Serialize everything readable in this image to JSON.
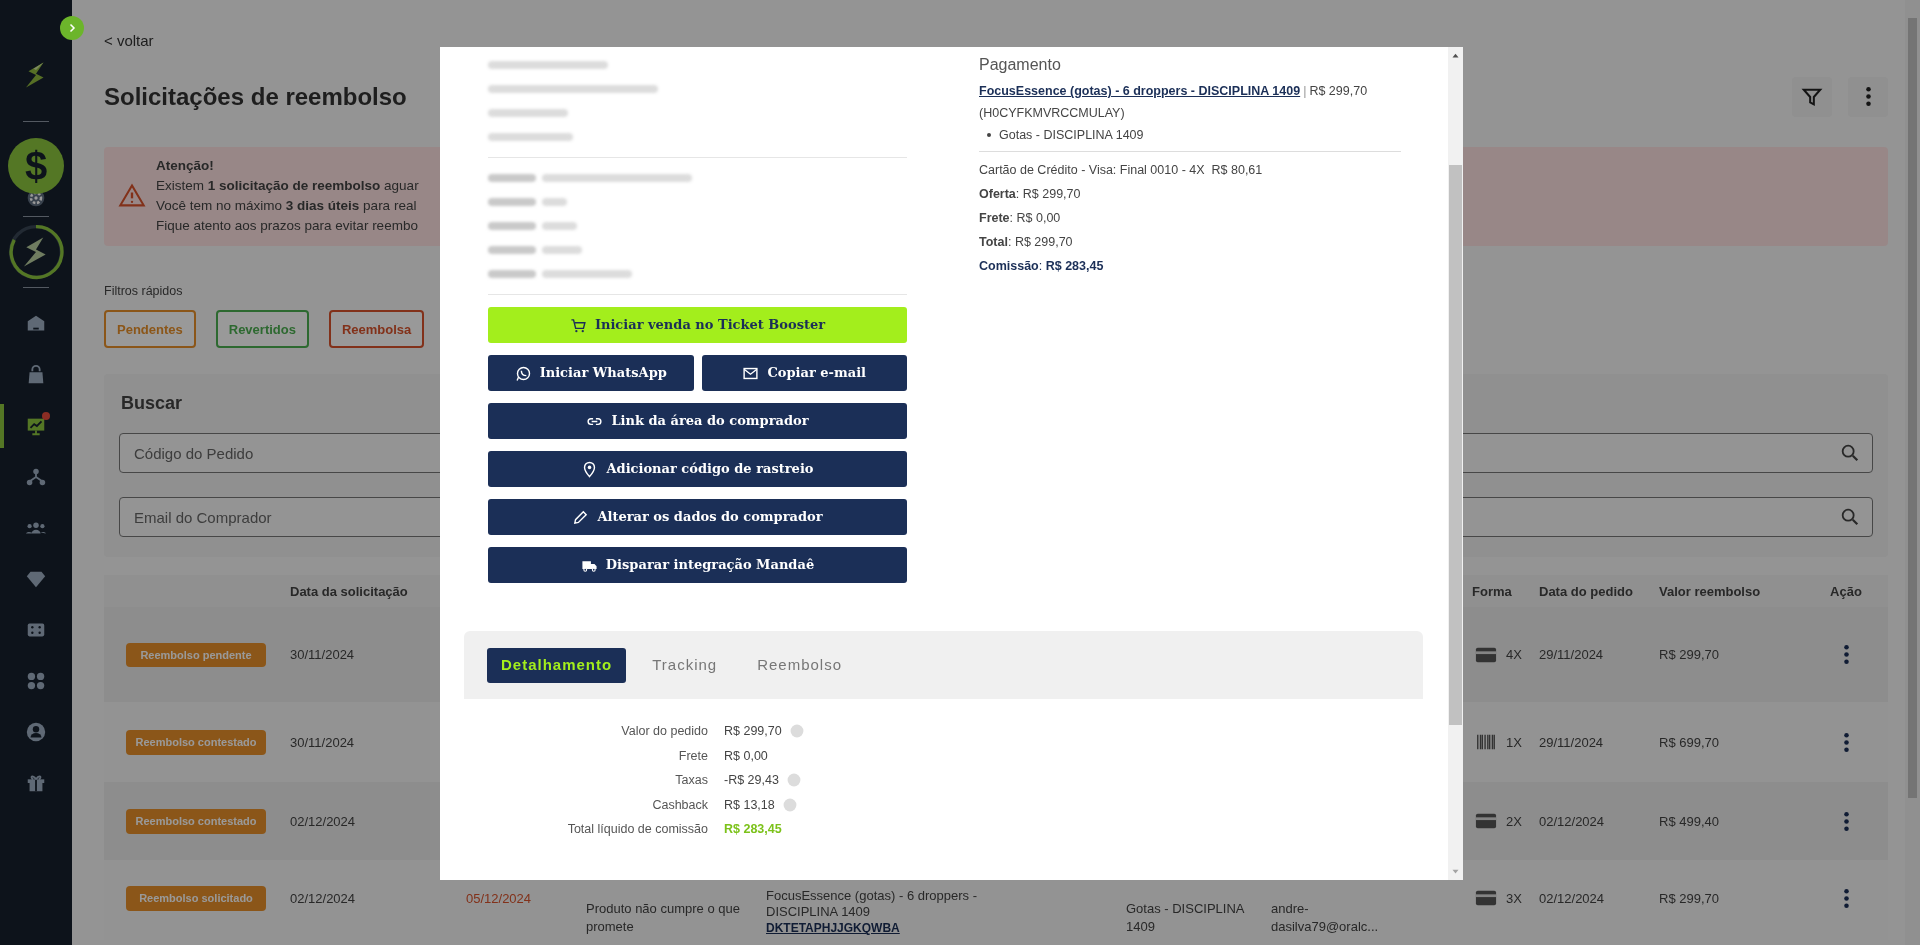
{
  "sidebar": {
    "balance_symbol": "$",
    "items": [
      {
        "selected": false,
        "alert": false
      },
      {
        "selected": false,
        "alert": false
      },
      {
        "selected": true,
        "alert": true
      },
      {
        "selected": false,
        "alert": false
      },
      {
        "selected": false,
        "alert": false
      },
      {
        "selected": false,
        "alert": false
      },
      {
        "selected": false,
        "alert": false
      },
      {
        "selected": false,
        "alert": false
      },
      {
        "selected": false,
        "alert": false
      },
      {
        "selected": false,
        "alert": false
      }
    ]
  },
  "back_link": "< voltar",
  "title": "Solicitações de reembolso",
  "alert": {
    "title": "Atenção!",
    "lines": [
      "Existem **1 solicitação de reembolso** aguar",
      "Você tem no máximo **3 dias úteis** para real",
      "Fique atento aos prazos para evitar reembo"
    ]
  },
  "quick_filters": {
    "label": "Filtros rápidos",
    "items": [
      {
        "label": "Pendentes",
        "kind": "pending"
      },
      {
        "label": "Revertidos",
        "kind": "reverted"
      },
      {
        "label": "Reembolsa",
        "kind": "refunded"
      }
    ]
  },
  "search": {
    "title": "Buscar",
    "fields": [
      {
        "placeholder": "Código do Pedido"
      },
      {
        "placeholder": "Email do Comprador"
      }
    ]
  },
  "table": {
    "columns": [
      "Data da solicitação",
      "Forma",
      "Data do pedido",
      "Valor reembolso",
      "Ação"
    ],
    "rows": [
      {
        "status": "Reembolso pendente",
        "request_date": "30/11/2024",
        "kind": "card",
        "installments": "4X",
        "order_date": "29/11/2024",
        "amount": "R$ 299,70"
      },
      {
        "status": "Reembolso contestado",
        "request_date": "30/11/2024",
        "kind": "boleto",
        "installments": "1X",
        "order_date": "29/11/2024",
        "amount": "R$ 699,70"
      },
      {
        "status": "Reembolso contestado",
        "request_date": "02/12/2024",
        "kind": "card",
        "installments": "2X",
        "order_date": "02/12/2024",
        "amount": "R$ 499,40"
      },
      {
        "status": "Reembolso solicitado",
        "request_date": "02/12/2024",
        "deadline": "05/12/2024",
        "reason": "Produto não cumpre o que promete",
        "product": "FocusEssence (gotas) - 6 droppers - DISCIPLINA 1409",
        "code": "DKTETAPHJJGKQWBA",
        "offer": "Gotas - DISCIPLINA 1409",
        "email": "andre-dasilva79@oralc...",
        "kind": "card",
        "installments": "3X",
        "order_date": "02/12/2024",
        "amount": "R$ 299,70"
      }
    ]
  },
  "modal": {
    "actions": [
      {
        "label": "Iniciar venda no Ticket Booster",
        "kind": "primary"
      },
      {
        "label": "Iniciar WhatsApp",
        "kind": "half"
      },
      {
        "label": "Copiar e-mail",
        "kind": "half"
      },
      {
        "label": "Link da área do comprador",
        "kind": "full"
      },
      {
        "label": "Adicionar código de rastreio",
        "kind": "full"
      },
      {
        "label": "Alterar os dados do comprador",
        "kind": "full"
      },
      {
        "label": "Disparar integração Mandaê",
        "kind": "full"
      }
    ],
    "payment": {
      "heading": "Pagamento",
      "product_link": "FocusEssence (gotas) - 6 droppers - DISCIPLINA 1409",
      "separator": "|",
      "product_price": "R$ 299,70",
      "product_code": "(H0CYFKMVRCCMULAY)",
      "offer": "Gotas - DISCIPLINA 1409",
      "method": "Cartão de Crédito - Visa: Final 0010 - 4X  R$ 80,61",
      "lines": [
        {
          "text": "**Oferta**: R$ 299,70",
          "emphasis": false
        },
        {
          "text": "**Frete**: R$ 0,00",
          "emphasis": false
        },
        {
          "text": "**Total**: R$ 299,70",
          "emphasis": false
        },
        {
          "text": "**Comissão**: **R$ 283,45**",
          "emphasis": true
        }
      ]
    },
    "tabs": [
      {
        "label": "Detalhamento",
        "selected": true
      },
      {
        "label": "Tracking",
        "selected": false
      },
      {
        "label": "Reembolso",
        "selected": false
      }
    ],
    "details": [
      {
        "label": "Valor do pedido",
        "value": "R$ 299,70",
        "info": true,
        "kind": "plain"
      },
      {
        "label": "Frete",
        "value": "R$ 0,00",
        "info": false,
        "kind": "plain"
      },
      {
        "label": "Taxas",
        "value": "-R$ 29,43",
        "info": true,
        "kind": "plain"
      },
      {
        "label": "Cashback",
        "value": "R$ 13,18",
        "info": true,
        "kind": "plain"
      },
      {
        "label": "Total líquido de comissão",
        "value": "R$ 283,45",
        "info": false,
        "kind": "total"
      }
    ]
  }
}
